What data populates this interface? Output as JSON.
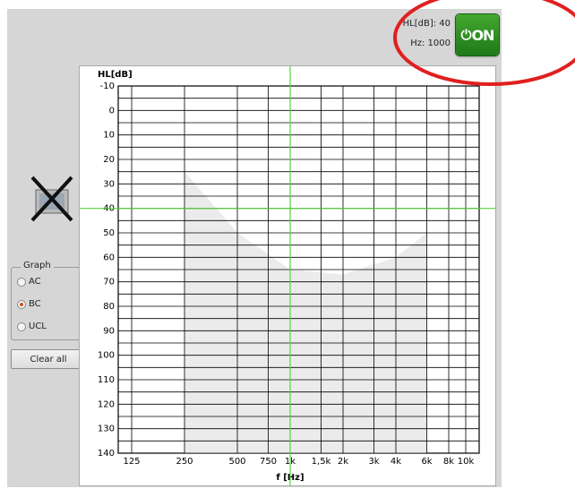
{
  "readout": {
    "hl_label": "HL[dB]: 40",
    "hz_label": "Hz: 1000"
  },
  "power_button": {
    "label": "ON",
    "state": "on",
    "color": "#2e9a23"
  },
  "graph_group": {
    "title": "Graph",
    "options": [
      {
        "label": "AC",
        "selected": false
      },
      {
        "label": "BC",
        "selected": true
      },
      {
        "label": "UCL",
        "selected": false
      }
    ]
  },
  "clear_button": {
    "label": "Clear all"
  },
  "chart_data": {
    "type": "line",
    "ylabel": "HL[dB]",
    "xlabel": "f [Hz]",
    "ylim": [
      140,
      -10
    ],
    "y_ticks": [
      "-10",
      "0",
      "10",
      "20",
      "30",
      "40",
      "50",
      "60",
      "70",
      "80",
      "90",
      "100",
      "110",
      "120",
      "130",
      "140"
    ],
    "x_ticks": [
      "125",
      "250",
      "500",
      "750",
      "1k",
      "1,5k",
      "2k",
      "3k",
      "4k",
      "6k",
      "8k",
      "10k"
    ],
    "x_values": [
      125,
      250,
      500,
      750,
      1000,
      1500,
      2000,
      3000,
      4000,
      6000,
      8000,
      10000
    ],
    "cursor": {
      "frequency_hz": 1000,
      "level_db": 40,
      "color": "#55d43a"
    },
    "shaded_region": {
      "color": "#ebebeb",
      "x": [
        250,
        500,
        1000,
        2000,
        4000,
        6000
      ],
      "y_top": [
        25,
        50,
        65,
        67,
        60,
        50
      ],
      "y_bottom": [
        140,
        140,
        140,
        140,
        140,
        140
      ]
    },
    "grid": true
  },
  "annotation": {
    "color": "#e02020"
  }
}
